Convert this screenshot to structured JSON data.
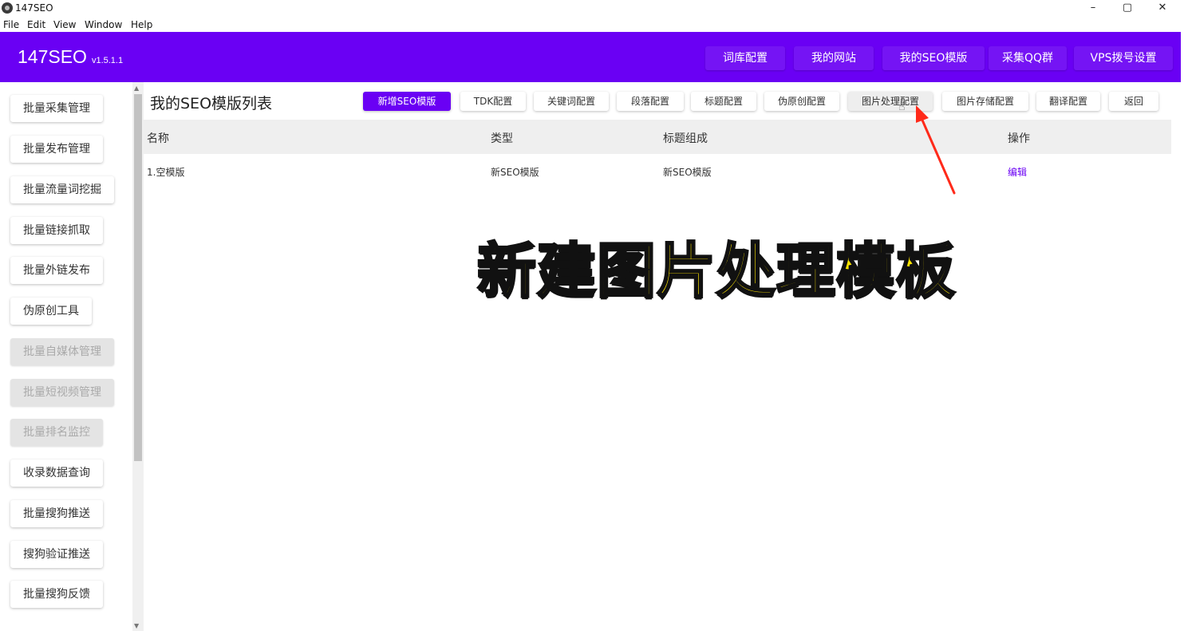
{
  "window": {
    "title": "147SEO",
    "controls": {
      "minimize": "–",
      "maximize": "▢",
      "close": "✕"
    }
  },
  "menu": [
    "File",
    "Edit",
    "View",
    "Window",
    "Help"
  ],
  "header": {
    "brand": "147SEO",
    "version": "v1.5.1.1",
    "nav": [
      "词库配置",
      "我的网站",
      "我的SEO模版",
      "采集QQ群",
      "VPS拨号设置"
    ],
    "color": "#6a00f4"
  },
  "sidebar": {
    "items": [
      {
        "label": "批量采集管理",
        "disabled": false
      },
      {
        "label": "批量发布管理",
        "disabled": false
      },
      {
        "label": "批量流量词挖掘",
        "disabled": false
      },
      {
        "label": "批量链接抓取",
        "disabled": false
      },
      {
        "label": "批量外链发布",
        "disabled": false
      },
      {
        "label": "伪原创工具",
        "disabled": false
      },
      {
        "label": "批量自媒体管理",
        "disabled": true
      },
      {
        "label": "批量短视频管理",
        "disabled": true
      },
      {
        "label": "批量排名监控",
        "disabled": true
      },
      {
        "label": "收录数据查询",
        "disabled": false
      },
      {
        "label": "批量搜狗推送",
        "disabled": false
      },
      {
        "label": "搜狗验证推送",
        "disabled": false
      },
      {
        "label": "批量搜狗反馈",
        "disabled": false
      }
    ]
  },
  "main": {
    "title": "我的SEO模版列表",
    "toolbar": [
      "新增SEO模版",
      "TDK配置",
      "关键词配置",
      "段落配置",
      "标题配置",
      "伪原创配置",
      "图片处理配置",
      "图片存储配置",
      "翻译配置",
      "返回"
    ],
    "table": {
      "headers": [
        "名称",
        "类型",
        "标题组成",
        "操作"
      ],
      "rows": [
        {
          "name": "1.空模版",
          "type": "新SEO模版",
          "title_compose": "新SEO模版",
          "action": "编辑"
        }
      ]
    }
  },
  "overlay": {
    "caption": "新建图片处理模板",
    "color": "#ffe600",
    "arrow_color": "#ff2a1a"
  }
}
